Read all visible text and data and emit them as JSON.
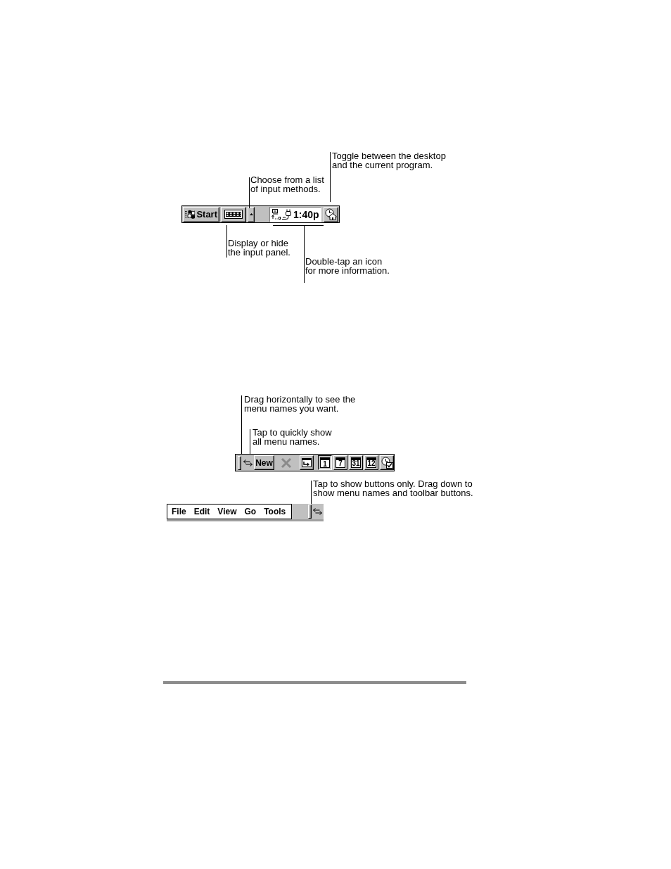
{
  "figure_1": {
    "callouts": [
      {
        "text": "Toggle between the desktop\nand the current program."
      },
      {
        "text": "Choose from a list\nof input methods."
      },
      {
        "text": "Display or hide\nthe input panel."
      },
      {
        "text": "Double-tap an icon\nfor more information."
      }
    ],
    "taskbar": {
      "start_button": {
        "label": "Start"
      },
      "clock": "1:40p"
    }
  },
  "figure_2": {
    "callouts": [
      {
        "text": "Drag horizontally to see the\nmenu names you want."
      },
      {
        "text": "Tap to quickly show\nall menu names."
      },
      {
        "text": "Tap to show buttons only. Drag down to\nshow menu names and toolbar buttons."
      }
    ],
    "command_bar": {
      "items": [
        {
          "kind": "grip"
        },
        {
          "kind": "swap"
        },
        {
          "kind": "text",
          "label": "New"
        },
        {
          "kind": "delete",
          "disabled": true
        },
        {
          "kind": "tool"
        },
        {
          "kind": "calendar",
          "label": "1",
          "selected": true
        },
        {
          "kind": "calendar",
          "label": "7",
          "selected": false
        },
        {
          "kind": "calendar",
          "label": "31",
          "selected": false
        },
        {
          "kind": "calendar",
          "label": "12",
          "selected": false
        },
        {
          "kind": "today"
        }
      ]
    },
    "menu_bar": {
      "menus": [
        "File",
        "Edit",
        "View",
        "Go",
        "Tools"
      ]
    }
  }
}
